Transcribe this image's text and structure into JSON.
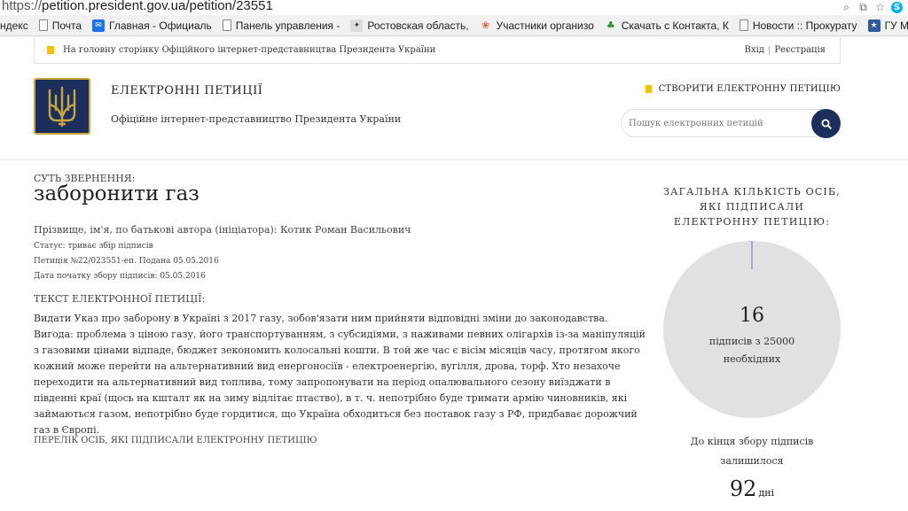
{
  "browser": {
    "url_scheme": "https://",
    "url_rest": "petition.president.gov.ua/petition/23551",
    "bookmarks": [
      {
        "label": "ндекс",
        "icon": "none"
      },
      {
        "label": "Почта",
        "icon": "page-icon"
      },
      {
        "label": "Главная - Официаль",
        "icon": "mail-icon"
      },
      {
        "label": "Панель управления -",
        "icon": "page-icon"
      },
      {
        "label": "Ростовская область,",
        "icon": "gov-emblem-icon"
      },
      {
        "label": "Участники организо",
        "icon": "globe-icon"
      },
      {
        "label": "Скачать с Контакта, К",
        "icon": "tree-icon"
      },
      {
        "label": "Новости :: Прокурату",
        "icon": "page-icon"
      },
      {
        "label": "ГУ МВД России по Р",
        "icon": "mvd-icon"
      }
    ]
  },
  "topstrip": {
    "home_link": "На головну сторінку Офіційного інтернет-представництва Президента України",
    "login": "Вхід",
    "separator": "|",
    "register": "Реєстрація"
  },
  "header": {
    "title": "ЕЛЕКТРОННІ ПЕТИЦІЇ",
    "subtitle": "Офіційне інтернет-представництво Президента України",
    "create_button": "СТВОРИТИ ЕЛЕКТРОННУ ПЕТИЦІЮ",
    "search_placeholder": "Пошук електронних петицій"
  },
  "petition": {
    "essence_label": "СУТЬ ЗВЕРНЕННЯ:",
    "title": "заборонити газ",
    "author": "Прізвище, ім'я, по батькові автора (ініціатора): Котик Роман Васильович",
    "status": "Статус: триває збір підписів",
    "number": "Петиція №22/023551-еп. Подана 05.05.2016",
    "start_date": "Дата початку збору підписів: 05.05.2016",
    "text_label": "ТЕКСТ ЕЛЕКТРОННОЇ ПЕТИЦІЇ:",
    "text_line1": "Видати Указ про заборону в Україні з 2017 газу, зобов'язати ним прийняти відповідні зміни до законодавства.",
    "text_line2": "Вигода: проблема з ціною газу, його транспортуванням, з субсидіями, з наживами певних олігархів із-за маніпуляцій з газовими цінами відпаде, бюджет зекономить колосальні кошти. В той же час є вісім місяців часу, протягом якого кожний може перейти на альтернативний вид енергоносіїв - електроенергію, вугілля, дрова, торф. Хто незахоче переходити на альтернативний вид топлива, тому запропонувати на період опалювального сезону виїзджати в південні краї (щось на кшталт як на зиму відлітає птаство), в т. ч. непотрібно буде тримати армію чиновників, які займаються газом, непотрібно буде гордитися, що Україна обходиться без поставок газу з РФ, придбаває дорожчий газ в Європі.",
    "signers_label": "ПЕРЕЛІК ОСІБ, ЯКІ ПІДПИСАЛИ ЕЛЕКТРОННУ ПЕТИЦІЮ"
  },
  "stats": {
    "total_label_1": "ЗАГАЛЬНА КІЛЬКІСТЬ ОСІБ,",
    "total_label_2": "ЯКІ ПІДПИСАЛИ",
    "total_label_3": "ЕЛЕКТРОННУ ПЕТИЦІЮ:",
    "signed": "16",
    "needed_line1": "підписів з 25000",
    "needed_line2": "необхідних",
    "progress_fraction": 0.00064,
    "remaining_label_1": "До кінця збору підписів",
    "remaining_label_2": "залишилося",
    "days": "92",
    "days_unit": "дні"
  },
  "colors": {
    "navy": "#1c2f5c",
    "gold": "#c9a640",
    "yellow": "#f2c200",
    "circle_gray": "#e1e1e1"
  }
}
